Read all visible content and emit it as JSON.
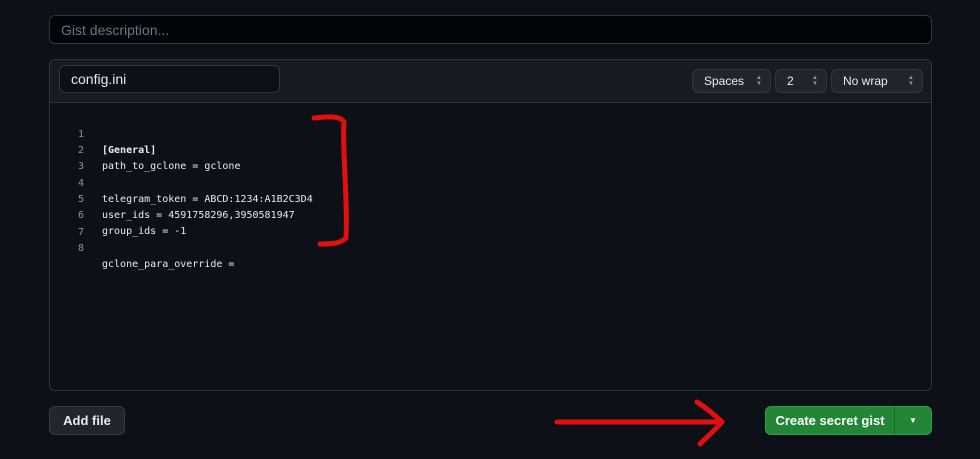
{
  "description": {
    "placeholder": "Gist description..."
  },
  "file": {
    "filename": "config.ini",
    "indent_mode": "Spaces",
    "indent_size": "2",
    "wrap_mode": "No wrap",
    "lines": [
      {
        "num": "1",
        "text": "[General]"
      },
      {
        "num": "2",
        "text": "path_to_gclone = gclone"
      },
      {
        "num": "3",
        "text": ""
      },
      {
        "num": "4",
        "text": "telegram_token = ABCD:1234:A1B2C3D4"
      },
      {
        "num": "5",
        "text": "user_ids = 4591758296,3950581947"
      },
      {
        "num": "6",
        "text": "group_ids = -1"
      },
      {
        "num": "7",
        "text": ""
      },
      {
        "num": "8",
        "text": "gclone_para_override ="
      }
    ]
  },
  "actions": {
    "add_file_label": "Add file",
    "create_label": "Create secret gist",
    "dropdown_icon": "caret-down-icon"
  },
  "colors": {
    "accent_green": "#238636",
    "annotation_red": "#e01010"
  }
}
